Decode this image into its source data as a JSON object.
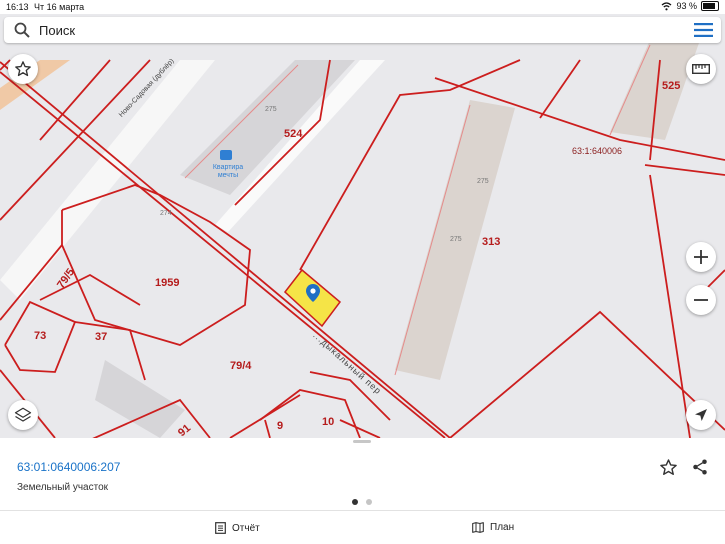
{
  "status_bar": {
    "time": "16:13",
    "date": "Чт 16 марта",
    "battery": "93 %"
  },
  "search": {
    "placeholder": "Поиск"
  },
  "map": {
    "street_label": "Ново-Садовая (дублёр)",
    "street_label_2": "...дыкальный пер",
    "poi_label": "Квартира мечты",
    "numbers": {
      "n524": "524",
      "n525": "525",
      "n313": "313",
      "n1959": "1959",
      "n79_5": "79/5",
      "n73": "73",
      "n37": "37",
      "n79_4": "79/4",
      "n10": "10",
      "n9": "9",
      "n91": "91",
      "n275a": "275",
      "n275b": "275",
      "n275c": "275",
      "n274": "274",
      "quarter": "63:1:640006"
    }
  },
  "parcel": {
    "cadastral_number": "63:01:0640006:207",
    "type": "Земельный участок"
  },
  "pager": {
    "count": 2,
    "active": 0
  },
  "tabs": {
    "report": "Отчёт",
    "plan": "План"
  },
  "colors": {
    "accent": "#1a73c8",
    "boundary": "#cc1e1e",
    "highlight": "#f7e32a"
  }
}
